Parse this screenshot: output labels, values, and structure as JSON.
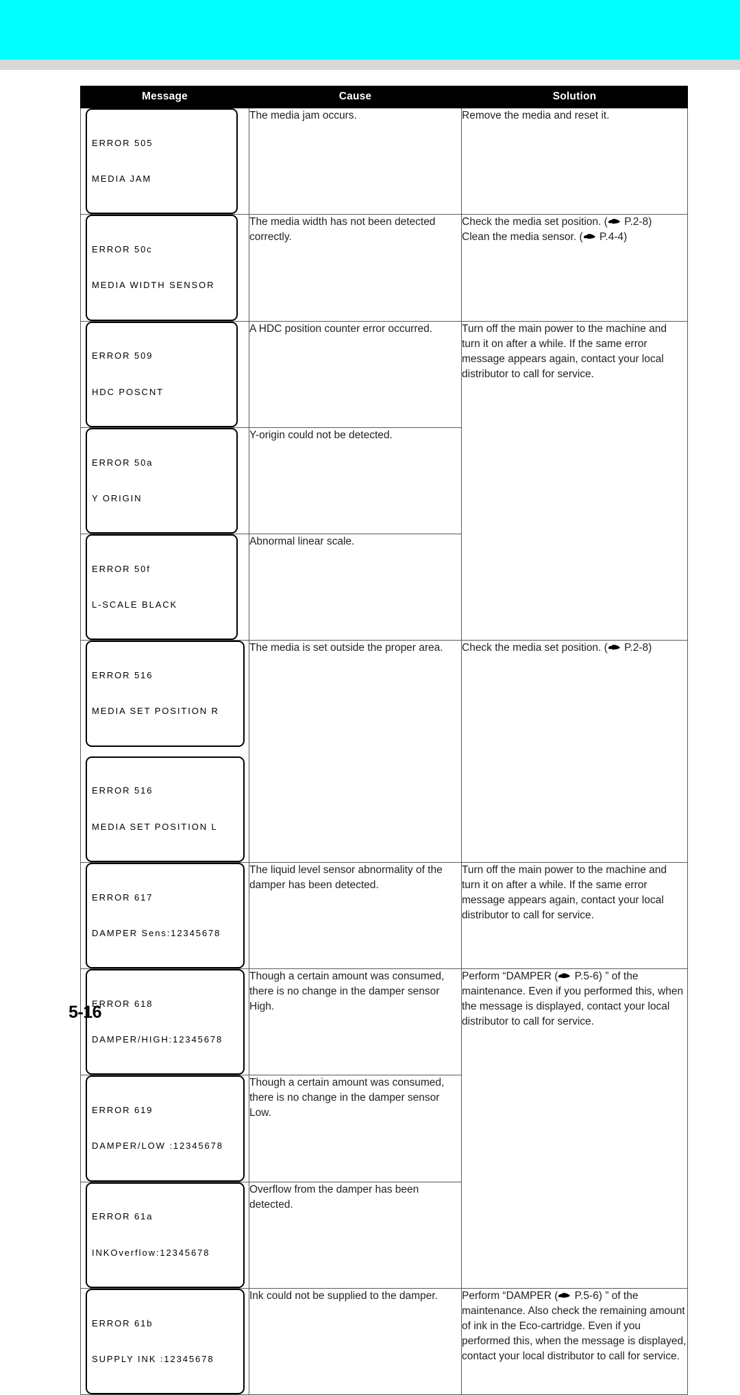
{
  "page": {
    "number": "5-16",
    "top_band_color": "#00ffff",
    "top_band_secondary_color": "#d8d8d8"
  },
  "table": {
    "headers": {
      "message": "Message",
      "cause": "Cause",
      "solution": "Solution"
    },
    "rows": [
      {
        "id": "err-505",
        "lcd": [
          {
            "lines": [
              "ERROR 505",
              "MEDIA JAM"
            ]
          }
        ],
        "cause": "The media jam occurs.",
        "solution_pre": "Remove the media and reset it.",
        "solution_icon": false
      },
      {
        "id": "err-50c",
        "lcd": [
          {
            "lines": [
              "ERROR 50c",
              "MEDIA WIDTH SENSOR"
            ]
          }
        ],
        "cause": "The media width has not been detected correctly.",
        "solution_pre": "Check the media set position. (",
        "solution_icon": true,
        "solution_post": " P.2-8)",
        "solution_pre2": "Clean the media sensor. (",
        "solution_icon2": true,
        "solution_post2": " P.4-4)"
      },
      {
        "id": "err-509",
        "lcd": [
          {
            "lines": [
              "ERROR 509",
              "HDC POSCNT"
            ]
          }
        ],
        "cause": "A HDC position counter error occurred."
      },
      {
        "id": "err-50a",
        "lcd": [
          {
            "lines": [
              "ERROR 50a",
              "Y ORIGIN"
            ]
          }
        ],
        "cause": "Y-origin could not be detected."
      },
      {
        "id": "err-50f",
        "lcd": [
          {
            "lines": [
              "ERROR 50f",
              "L-SCALE BLACK"
            ]
          }
        ],
        "cause": "Abnormal linear scale."
      },
      {
        "id": "err-516",
        "lcd": [
          {
            "lines": [
              "ERROR 516",
              "MEDIA SET POSITION R"
            ]
          },
          {
            "lines": [
              "ERROR 516",
              "MEDIA SET POSITION L"
            ]
          }
        ],
        "cause": "The media is set outside the proper area.",
        "solution_pre": "Check the media set position. (",
        "solution_icon": true,
        "solution_post": " P.2-8)"
      },
      {
        "id": "err-617",
        "lcd": [
          {
            "lines": [
              "ERROR 617",
              "DAMPER Sens:12345678"
            ]
          }
        ],
        "cause": "The liquid level sensor abnormality of the damper has been detected."
      },
      {
        "id": "err-618",
        "lcd": [
          {
            "lines": [
              "ERROR 618",
              "DAMPER/HIGH:12345678"
            ]
          }
        ],
        "cause": "Though a certain amount was consumed, there is no change in the damper sensor High."
      },
      {
        "id": "err-619",
        "lcd": [
          {
            "lines": [
              "ERROR 619",
              "DAMPER/LOW :12345678"
            ]
          }
        ],
        "cause": "Though a certain amount was consumed, there is no change in the damper sensor Low."
      },
      {
        "id": "err-61a",
        "lcd": [
          {
            "lines": [
              "ERROR 61a",
              "INKOverflow:12345678"
            ]
          }
        ],
        "cause": "Overflow from the damper has been detected."
      },
      {
        "id": "err-61b",
        "lcd": [
          {
            "lines": [
              "ERROR 61b",
              "SUPPLY INK :12345678"
            ]
          }
        ],
        "cause": "Ink could not be supplied to the damper."
      }
    ],
    "shared_solutions": {
      "power_cycle": "Turn off the main power to the machine and turn it on after a while. If the same error message appears again, contact your local distributor to call for service.",
      "damper_pre": "Perform “DAMPER (",
      "damper_post": " P.5-6) ” of the maintenance.",
      "damper_tail": "Even if you performed this, when the message is displayed, contact your local distributor to call for service.",
      "damper_ink_post": " P.5-6) ” of the maintenance. Also check the remaining amount of ink in the Eco-cartridge. Even if you performed this, when the message is displayed, contact your local distributor to call for service."
    },
    "icon_name": "pointing-hand-icon"
  }
}
